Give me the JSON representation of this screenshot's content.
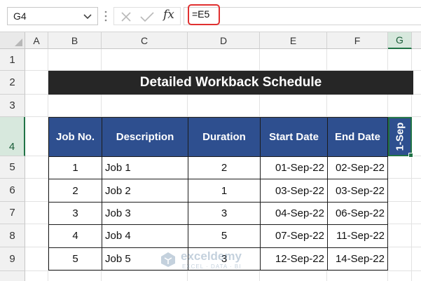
{
  "formula_bar": {
    "name_box": "G4",
    "fx_label": "fx",
    "formula": "=E5"
  },
  "columns": [
    "A",
    "B",
    "C",
    "D",
    "E",
    "F",
    "G"
  ],
  "rows": [
    "1",
    "2",
    "3",
    "4",
    "5",
    "6",
    "7",
    "8",
    "9"
  ],
  "sheet": {
    "title": "Detailed Workback Schedule",
    "headers": [
      "Job No.",
      "Description",
      "Duration",
      "Start Date",
      "End Date"
    ],
    "data_rows": [
      [
        "1",
        "Job 1",
        "2",
        "01-Sep-22",
        "02-Sep-22"
      ],
      [
        "2",
        "Job 2",
        "1",
        "03-Sep-22",
        "03-Sep-22"
      ],
      [
        "3",
        "Job 3",
        "3",
        "04-Sep-22",
        "06-Sep-22"
      ],
      [
        "4",
        "Job 4",
        "5",
        "07-Sep-22",
        "11-Sep-22"
      ],
      [
        "5",
        "Job 5",
        "3",
        "12-Sep-22",
        "14-Sep-22"
      ]
    ],
    "selected_cell_value": "1-Sep"
  },
  "watermark": {
    "title": "exceldemy",
    "subtitle": "EXCEL · DATA · BI"
  },
  "colors": {
    "header_fill": "#2e4f8f",
    "title_fill": "#262626",
    "selection": "#217346",
    "formula_highlight": "#e03030"
  }
}
